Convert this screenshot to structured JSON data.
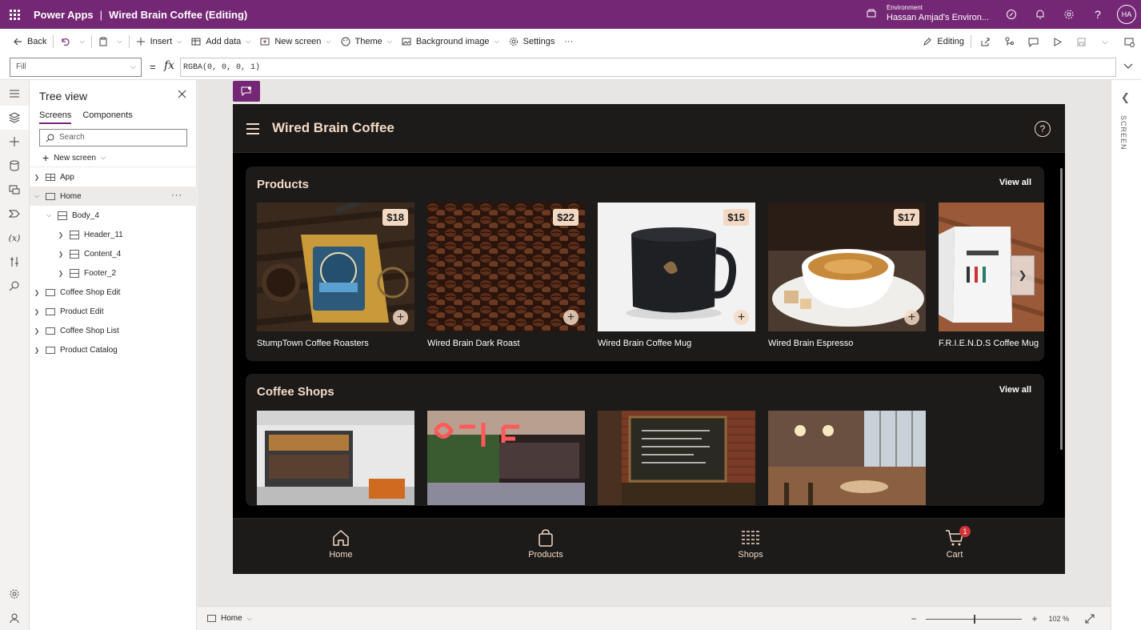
{
  "topbar": {
    "app_name": "Power Apps",
    "separator": "|",
    "doc_title": "Wired Brain Coffee (Editing)",
    "env_label": "Environment",
    "env_name": "Hassan Amjad's Environ...",
    "avatar_initials": "HA"
  },
  "command_bar": {
    "back": "Back",
    "insert": "Insert",
    "add_data": "Add data",
    "new_screen": "New screen",
    "theme": "Theme",
    "background_image": "Background image",
    "settings": "Settings",
    "more": "···",
    "editing": "Editing"
  },
  "formula_bar": {
    "property": "Fill",
    "equals": "=",
    "fx": "fx",
    "formula": "RGBA(0, 0, 0, 1)"
  },
  "tree": {
    "title": "Tree view",
    "tabs": [
      "Screens",
      "Components"
    ],
    "search_placeholder": "Search",
    "new_screen": "New screen",
    "nodes": [
      "App",
      "Home",
      "Body_4",
      "Header_11",
      "Content_4",
      "Footer_2",
      "Coffee Shop Edit",
      "Product Edit",
      "Coffee Shop List",
      "Product Catalog"
    ]
  },
  "app": {
    "title": "Wired Brain Coffee",
    "help": "?",
    "products": {
      "title": "Products",
      "view_all": "View all",
      "items": [
        {
          "name": "StumpTown Coffee Roasters",
          "price": "$18"
        },
        {
          "name": "Wired Brain Dark Roast",
          "price": "$22"
        },
        {
          "name": "Wired Brain Coffee Mug",
          "price": "$15"
        },
        {
          "name": "Wired Brain Espresso",
          "price": "$17"
        },
        {
          "name": "F.R.I.E.N.D.S Coffee Mug",
          "price": ""
        }
      ]
    },
    "shops": {
      "title": "Coffee Shops",
      "view_all": "View all"
    },
    "footer": {
      "home": "Home",
      "products": "Products",
      "shops": "Shops",
      "cart": "Cart",
      "cart_count": "1"
    }
  },
  "right_rail": {
    "label": "SCREEN"
  },
  "status_bar": {
    "screen": "Home",
    "zoom_minus": "−",
    "zoom_plus": "+",
    "zoom": "102 %"
  },
  "colors": {
    "brand": "#742774",
    "accent": "#f3d9c4",
    "app_bg": "#1c1b1a"
  }
}
